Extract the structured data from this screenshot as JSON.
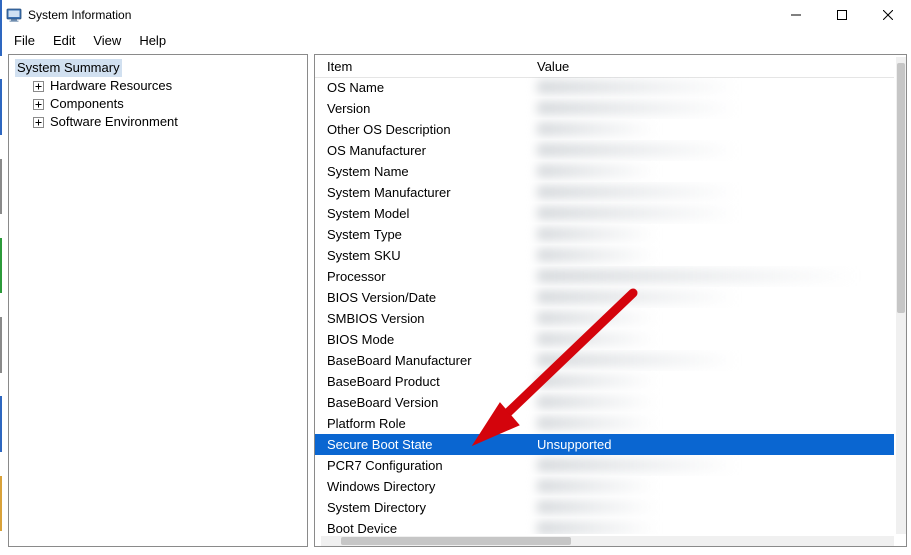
{
  "window": {
    "title": "System Information"
  },
  "menu": {
    "items": [
      "File",
      "Edit",
      "View",
      "Help"
    ]
  },
  "tree": {
    "root": "System Summary",
    "children": [
      "Hardware Resources",
      "Components",
      "Software Environment"
    ]
  },
  "list": {
    "headers": {
      "item": "Item",
      "value": "Value"
    },
    "rows": [
      {
        "item": "OS Name",
        "value": "",
        "blur": true,
        "blurw": "blur-med"
      },
      {
        "item": "Version",
        "value": "",
        "blur": true,
        "blurw": "blur-med"
      },
      {
        "item": "Other OS Description",
        "value": "",
        "blur": true,
        "blurw": "blur-short"
      },
      {
        "item": "OS Manufacturer",
        "value": "",
        "blur": true,
        "blurw": "blur-med"
      },
      {
        "item": "System Name",
        "value": "",
        "blur": true,
        "blurw": "blur-short"
      },
      {
        "item": "System Manufacturer",
        "value": "",
        "blur": true,
        "blurw": "blur-med"
      },
      {
        "item": "System Model",
        "value": "",
        "blur": true,
        "blurw": "blur-med"
      },
      {
        "item": "System Type",
        "value": "",
        "blur": true,
        "blurw": "blur-short"
      },
      {
        "item": "System SKU",
        "value": "",
        "blur": true,
        "blurw": "blur-short"
      },
      {
        "item": "Processor",
        "value": "",
        "blur": true,
        "blurw": "blur-long"
      },
      {
        "item": "BIOS Version/Date",
        "value": "",
        "blur": true,
        "blurw": "blur-med"
      },
      {
        "item": "SMBIOS Version",
        "value": "",
        "blur": true,
        "blurw": "blur-short"
      },
      {
        "item": "BIOS Mode",
        "value": "",
        "blur": true,
        "blurw": "blur-short"
      },
      {
        "item": "BaseBoard Manufacturer",
        "value": "",
        "blur": true,
        "blurw": "blur-med"
      },
      {
        "item": "BaseBoard Product",
        "value": "",
        "blur": true,
        "blurw": "blur-short"
      },
      {
        "item": "BaseBoard Version",
        "value": "",
        "blur": true,
        "blurw": "blur-short"
      },
      {
        "item": "Platform Role",
        "value": "",
        "blur": true,
        "blurw": "blur-short"
      },
      {
        "item": "Secure Boot State",
        "value": "Unsupported",
        "selected": true
      },
      {
        "item": "PCR7 Configuration",
        "value": "",
        "blur": true,
        "blurw": "blur-med"
      },
      {
        "item": "Windows Directory",
        "value": "",
        "blur": true,
        "blurw": "blur-short"
      },
      {
        "item": "System Directory",
        "value": "",
        "blur": true,
        "blurw": "blur-short"
      },
      {
        "item": "Boot Device",
        "value": "",
        "blur": true,
        "blurw": "blur-short"
      }
    ]
  },
  "annotation": {
    "arrow_color": "#d4040c"
  },
  "left_edge_colors": [
    "#2e67c0",
    "#2e67c0",
    "#8a8a8a",
    "#2c9a3a",
    "#8a8a8a",
    "#2e67c0",
    "#d9a23a"
  ]
}
